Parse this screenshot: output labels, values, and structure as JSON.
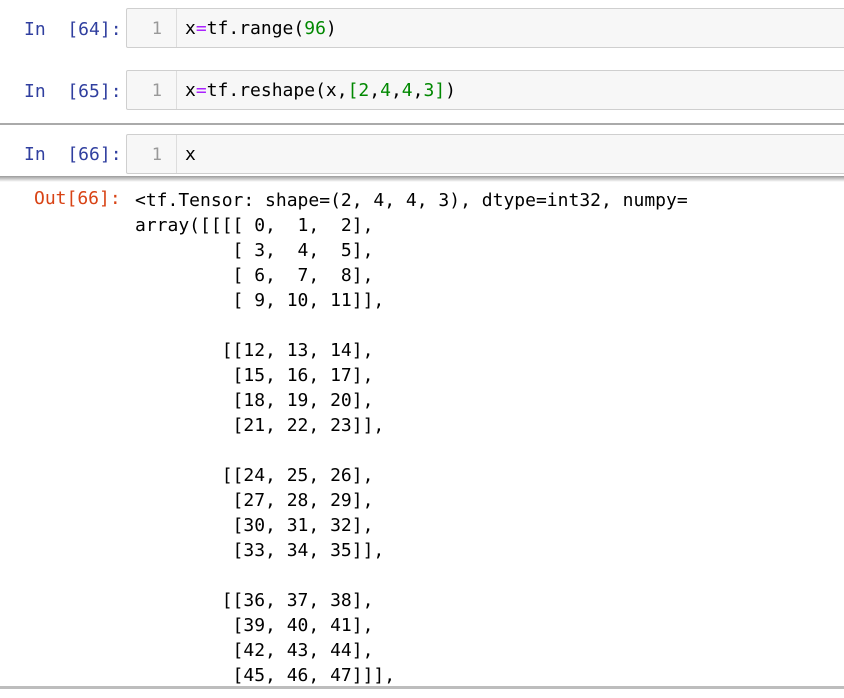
{
  "cells": [
    {
      "prompt": "In  [64]:",
      "line_number": "1",
      "code": {
        "p1": "x",
        "p2": "=",
        "p3": "tf.range",
        "p4": "(",
        "p5": "96",
        "p6": ")"
      }
    },
    {
      "prompt": "In  [65]:",
      "line_number": "1",
      "code": {
        "p1": "x",
        "p2": "=",
        "p3": "tf.reshape",
        "p4": "(x,",
        "p5": "[",
        "p6": "2",
        "p7": ",",
        "p8": "4",
        "p9": ",",
        "p10": "4",
        "p11": ",",
        "p12": "3",
        "p13": "]",
        "p14": ")"
      }
    },
    {
      "prompt": "In  [66]:",
      "line_number": "1",
      "code": {
        "p1": "x"
      }
    }
  ],
  "output": {
    "prompt": "Out[66]:",
    "text": "<tf.Tensor: shape=(2, 4, 4, 3), dtype=int32, numpy=\narray([[[[ 0,  1,  2],\n         [ 3,  4,  5],\n         [ 6,  7,  8],\n         [ 9, 10, 11]],\n\n        [[12, 13, 14],\n         [15, 16, 17],\n         [18, 19, 20],\n         [21, 22, 23]],\n\n        [[24, 25, 26],\n         [27, 28, 29],\n         [30, 31, 32],\n         [33, 34, 35]],\n\n        [[36, 37, 38],\n         [39, 40, 41],\n         [42, 43, 44],\n         [45, 46, 47]]],"
  },
  "colors": {
    "prompt_in": "#303f9f",
    "prompt_out": "#d84315",
    "number": "#008800",
    "operator": "#aa22ff"
  }
}
